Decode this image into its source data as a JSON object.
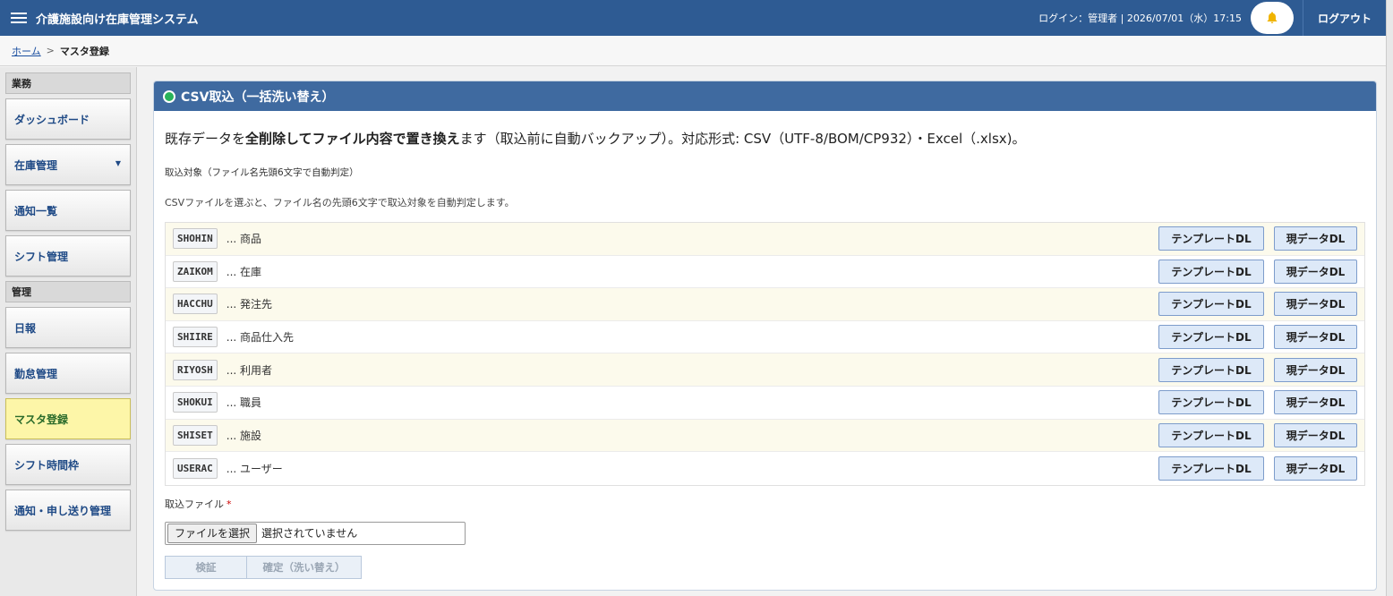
{
  "header": {
    "title": "介護施設向け在庫管理システム",
    "login_info": "ログイン：管理者 | 2026/07/01（水）17:15",
    "logout_label": "ログアウト",
    "bell_icon": "bell-icon"
  },
  "breadcrumb": {
    "home": "ホーム",
    "separator": ">",
    "current": "マスタ登録"
  },
  "sidebar": {
    "groups": [
      {
        "label": "業務"
      },
      {
        "label": "管理"
      }
    ],
    "items": [
      {
        "label": "ダッシュボード"
      },
      {
        "label": "在庫管理",
        "caret": "▼"
      },
      {
        "label": "通知一覧"
      },
      {
        "label": "シフト管理"
      },
      {
        "label": "日報"
      },
      {
        "label": "勤怠管理"
      },
      {
        "label": "マスタ登録",
        "active": true
      },
      {
        "label": "シフト時間枠"
      },
      {
        "label": "通知・申し送り管理"
      }
    ]
  },
  "card": {
    "title": "CSV取込（一括洗い替え）",
    "lead_pre": "既存データを",
    "lead_bold": "全削除してファイル内容で置き換え",
    "lead_post": "ます（取込前に自動バックアップ）。対応形式: CSV（UTF-8/BOM/CP932）・Excel（.xlsx)。",
    "target_label": "取込対象（ファイル名先頭6文字で自動判定）",
    "hint": "CSVファイルを選ぶと、ファイル名の先頭6文字で取込対象を自動判定します。",
    "template_btn": "テンプレートDL",
    "current_btn": "現データDL",
    "targets": [
      {
        "code": "SHOHIN",
        "desc": "... 商品"
      },
      {
        "code": "ZAIKOM",
        "desc": "... 在庫"
      },
      {
        "code": "HACCHU",
        "desc": "... 発注先"
      },
      {
        "code": "SHIIRE",
        "desc": "... 商品仕入先"
      },
      {
        "code": "RIYOSH",
        "desc": "... 利用者"
      },
      {
        "code": "SHOKUI",
        "desc": "... 職員"
      },
      {
        "code": "SHISET",
        "desc": "... 施設"
      },
      {
        "code": "USERAC",
        "desc": "... ユーザー"
      }
    ],
    "file_label": "取込ファイル",
    "required_mark": "*",
    "file_button": "ファイルを選択",
    "file_status": "選択されていません",
    "verify_btn": "検証",
    "commit_btn": "確定（洗い替え）"
  },
  "colors": {
    "header_bg": "#2e5b93",
    "card_header_bg": "#3f6aa0",
    "active_menu_bg": "#fdf6a8",
    "status_dot": "#29b35a"
  }
}
